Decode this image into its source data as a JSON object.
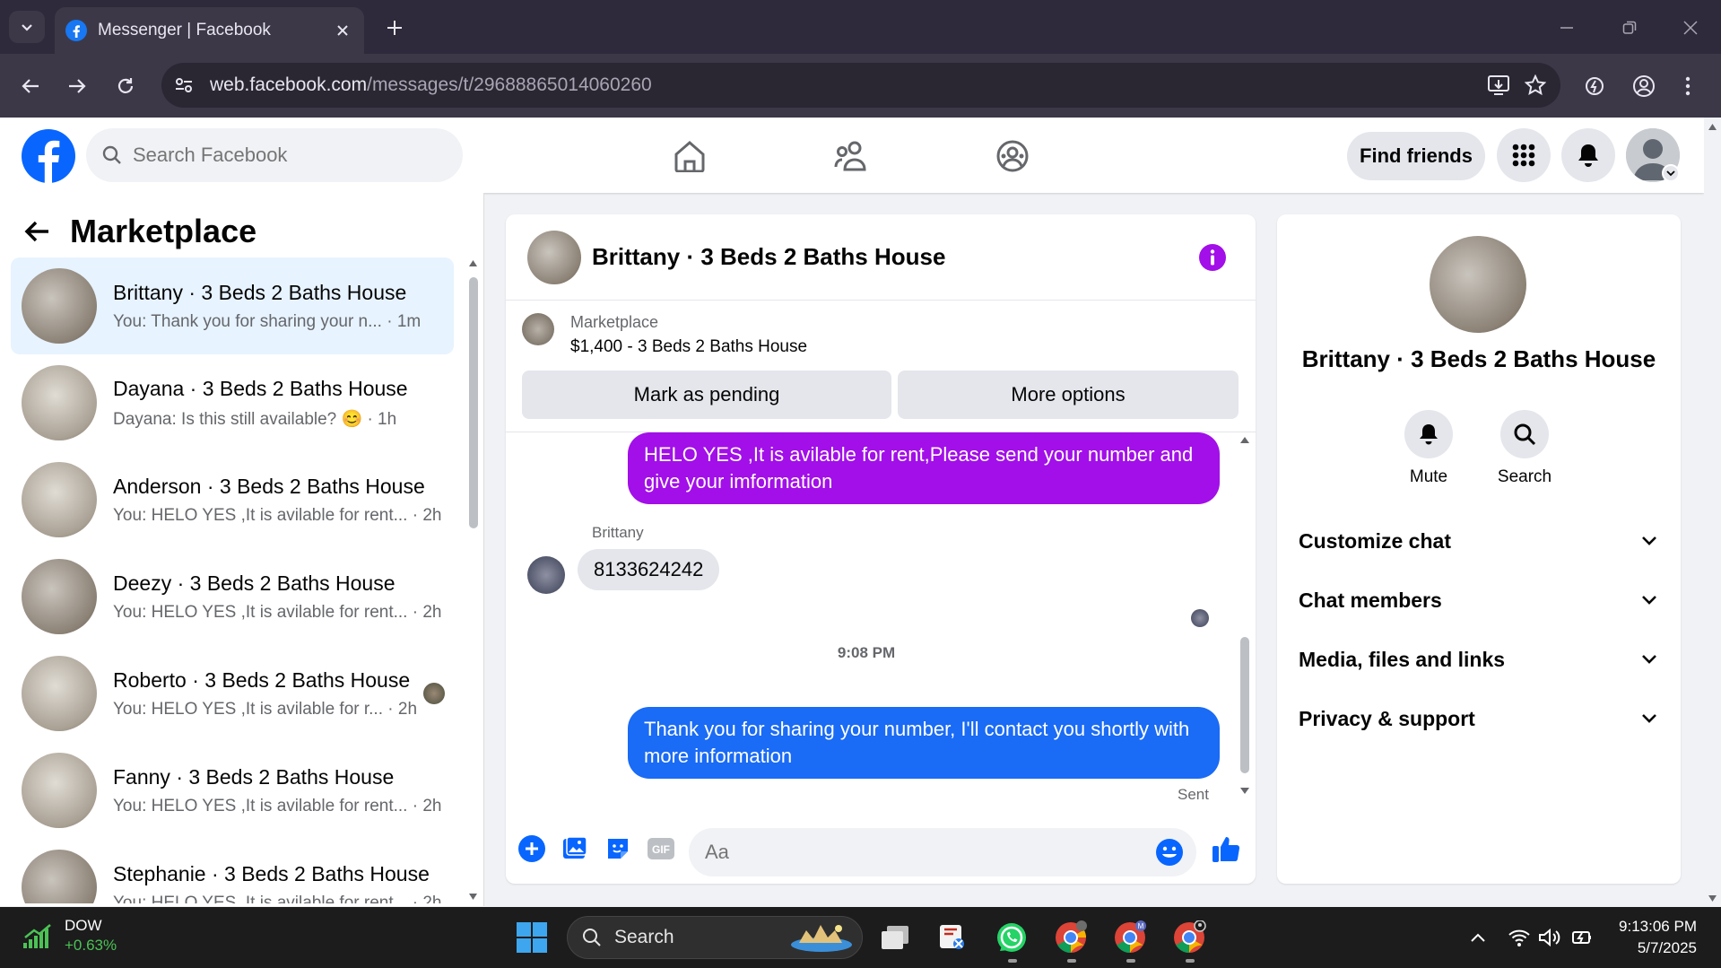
{
  "browser": {
    "tab_title": "Messenger | Facebook",
    "url_host": "web.facebook.com",
    "url_path": "/messages/t/29688865014060260"
  },
  "header": {
    "search_placeholder": "Search Facebook",
    "find_friends": "Find friends"
  },
  "left_panel": {
    "title": "Marketplace",
    "conversations": [
      {
        "name": "Brittany · 3 Beds 2 Baths House",
        "preview": "You: Thank you for sharing your n...",
        "time": "· 1m",
        "active": true
      },
      {
        "name": "Dayana · 3 Beds 2 Baths House",
        "preview": "Dayana: Is this still available? 😊",
        "time": "· 1h"
      },
      {
        "name": "Anderson · 3 Beds 2 Baths House",
        "preview": "You: HELO YES ,It is avilable for rent...",
        "time": "· 2h"
      },
      {
        "name": "Deezy · 3 Beds 2 Baths House",
        "preview": "You: HELO YES ,It is avilable for rent...",
        "time": "· 2h"
      },
      {
        "name": "Roberto · 3 Beds 2 Baths House",
        "preview": "You: HELO YES ,It is avilable for r...",
        "time": "· 2h"
      },
      {
        "name": "Fanny · 3 Beds 2 Baths House",
        "preview": "You: HELO YES ,It is avilable for rent...",
        "time": "· 2h"
      },
      {
        "name": "Stephanie · 3 Beds 2 Baths House",
        "preview": "You: HELO YES ,It is avilable for rent...",
        "time": "· 2h"
      }
    ]
  },
  "chat": {
    "title": "Brittany · 3 Beds 2 Baths House",
    "listing_category": "Marketplace",
    "listing_price": "$1,400 - 3 Beds 2 Baths House",
    "mark_pending": "Mark as pending",
    "more_options": "More options",
    "msg1": "HELO YES ,It is avilable for rent,Please send your number and give your imformation",
    "sender": "Brittany",
    "msg2": "8133624242",
    "timestamp": "9:08 PM",
    "msg3": "Thank you for sharing your number, I'll contact you shortly with more information",
    "status": "Sent",
    "input_placeholder": "Aa",
    "colors": {
      "purple": "#a20fe8",
      "blue": "#1a6bf5"
    }
  },
  "right_panel": {
    "name": "Brittany · 3 Beds 2 Baths House",
    "mute": "Mute",
    "search": "Search",
    "sections": [
      "Customize chat",
      "Chat members",
      "Media, files and links",
      "Privacy & support"
    ]
  },
  "taskbar": {
    "ticker": "DOW",
    "change": "+0.63%",
    "search": "Search",
    "time": "9:13:06 PM",
    "date": "5/7/2025"
  }
}
